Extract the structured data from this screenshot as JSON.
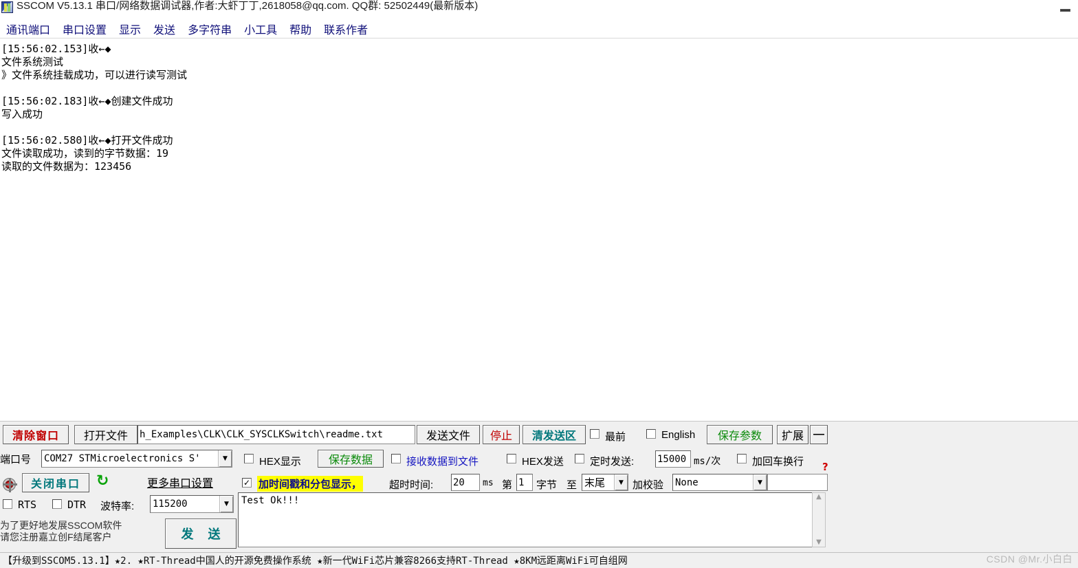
{
  "window": {
    "title": "SSCOM V5.13.1 串口/网络数据调试器,作者:大虾丁丁,2618058@qq.com. QQ群: 52502449(最新版本)",
    "minimize_label": "—"
  },
  "menubar": {
    "items": [
      {
        "label": "通讯端口"
      },
      {
        "label": "串口设置"
      },
      {
        "label": "显示"
      },
      {
        "label": "发送"
      },
      {
        "label": "多字符串"
      },
      {
        "label": "小工具"
      },
      {
        "label": "帮助"
      },
      {
        "label": "联系作者"
      }
    ]
  },
  "receive": {
    "lines": [
      "[15:56:02.153]收←◆",
      "文件系统测试",
      "》文件系统挂载成功，可以进行读写测试",
      "",
      "[15:56:02.183]收←◆创建文件成功",
      "写入成功",
      "",
      "[15:56:02.580]收←◆打开文件成功",
      "文件读取成功，读到的字节数据：19",
      "读取的文件数据为：123456"
    ]
  },
  "toolbar_row1": {
    "clear_window": "清除窗口",
    "open_file": "打开文件",
    "file_path": "h_Examples\\CLK\\CLK_SYSCLKSwitch\\readme.txt",
    "send_file": "发送文件",
    "stop": "停止",
    "clear_send": "清发送区",
    "topmost_checked": false,
    "topmost_label": "最前",
    "english_checked": false,
    "english_label": "English",
    "save_params": "保存参数",
    "expand": "扩展",
    "collapse": "—"
  },
  "toolbar_row2": {
    "port_label": "端口号",
    "port_value": "COM27 STMicroelectronics S'",
    "hex_display_checked": false,
    "hex_display_label": "HEX显示",
    "save_data": "保存数据",
    "recv_to_file_checked": false,
    "recv_to_file_label": "接收数据到文件",
    "hex_send_checked": false,
    "hex_send_label": "HEX发送",
    "timed_send_checked": false,
    "timed_send_label": "定时发送:",
    "timed_send_value": "15000",
    "timed_send_unit": "ms/次",
    "crlf_checked": false,
    "crlf_label": "加回车换行",
    "help_marker": "?"
  },
  "toolbar_row3": {
    "close_port": "关闭串口",
    "refresh_icon": "refresh-icon",
    "more_settings": "更多串口设置",
    "timestamp_checked": true,
    "timestamp_label": "加时间戳和分包显示，",
    "timeout_label": "超时时间:",
    "timeout_value": "20",
    "timeout_unit": "ms",
    "byte_from_label": "第",
    "byte_from_value": "1",
    "byte_unit_label": "字节",
    "byte_to_label": "至",
    "byte_to_value": "末尾",
    "checksum_label": "加校验",
    "checksum_value": "None"
  },
  "toolbar_row4": {
    "rts_checked": false,
    "rts_label": "RTS",
    "dtr_checked": false,
    "dtr_label": "DTR",
    "baud_label": "波特率:",
    "baud_value": "115200"
  },
  "send_area": {
    "text": "Test Ok!!!",
    "send_button": "发  送",
    "promo_line1": "为了更好地发展SSCOM软件",
    "promo_line2": "请您注册嘉立创F结尾客户"
  },
  "statusbar": {
    "text": "【升级到SSCOM5.13.1】★2.  ★RT-Thread中国人的开源免费操作系统 ★新一代WiFi芯片兼容8266支持RT-Thread ★8KM远距离WiFi可自组网"
  },
  "watermark": {
    "text": "CSDN @Mr.小白白"
  },
  "colors": {
    "accent_red": "#c00000",
    "accent_green": "#0a8a0a",
    "accent_teal": "#00777b",
    "accent_blue": "#1515c0",
    "highlight_yellow": "#ffff00",
    "menu_text": "#10107a"
  }
}
